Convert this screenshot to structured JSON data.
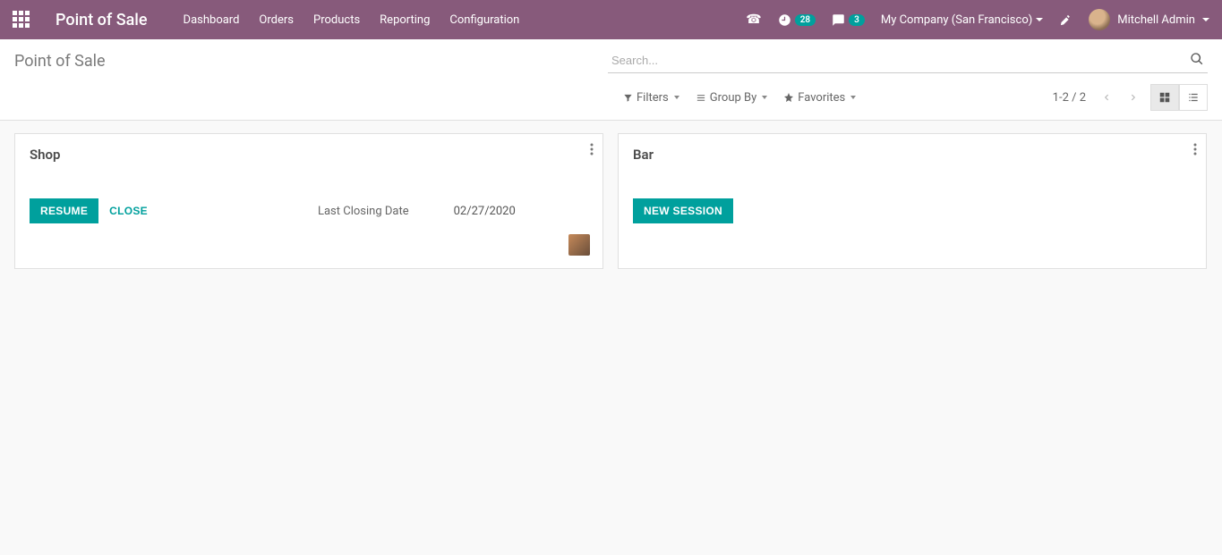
{
  "header": {
    "brand": "Point of Sale",
    "menu": [
      "Dashboard",
      "Orders",
      "Products",
      "Reporting",
      "Configuration"
    ],
    "clock_count": "28",
    "chat_count": "3",
    "company": "My Company (San Francisco)",
    "user_name": "Mitchell Admin"
  },
  "control_panel": {
    "breadcrumb": "Point of Sale",
    "search_placeholder": "Search...",
    "filters_label": "Filters",
    "groupby_label": "Group By",
    "favorites_label": "Favorites",
    "pager": "1-2 / 2"
  },
  "cards": [
    {
      "title": "Shop",
      "primary_btn": "RESUME",
      "secondary_btn": "CLOSE",
      "closing_label": "Last Closing Date",
      "closing_date": "02/27/2020",
      "has_avatar": true
    },
    {
      "title": "Bar",
      "primary_btn": "NEW SESSION",
      "secondary_btn": "",
      "closing_label": "",
      "closing_date": "",
      "has_avatar": false
    }
  ]
}
